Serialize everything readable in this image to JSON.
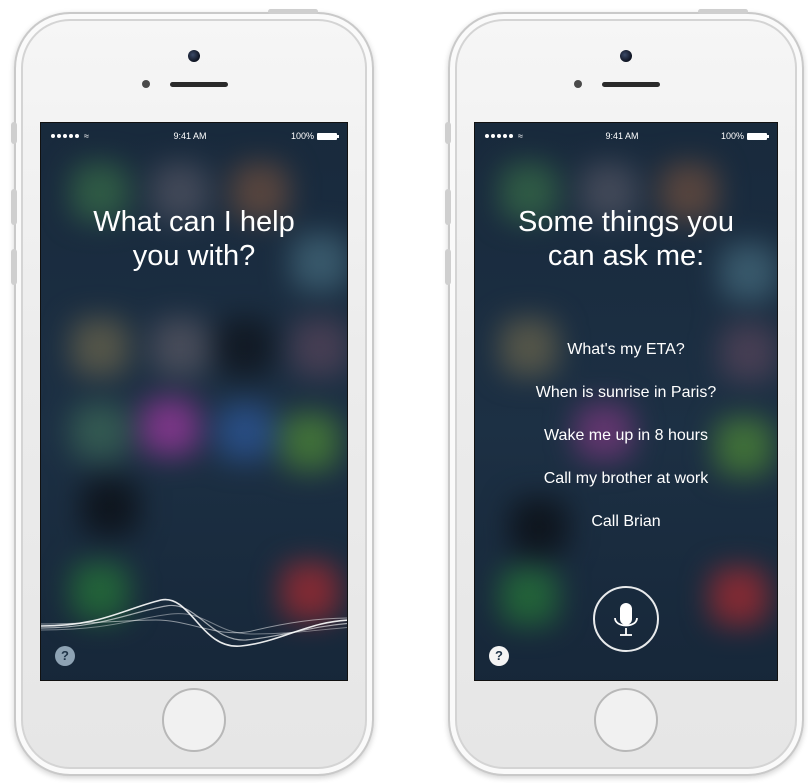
{
  "left_phone": {
    "status": {
      "time": "9:41 AM",
      "battery": "100%",
      "signal_dots": 5,
      "wifi_icon": "wifi-icon"
    },
    "prompt_lines": [
      "What can I help",
      "you with?"
    ],
    "help_label": "?",
    "indicator": "siri-waveform"
  },
  "right_phone": {
    "status": {
      "time": "9:41 AM",
      "battery": "100%",
      "signal_dots": 5,
      "wifi_icon": "wifi-icon"
    },
    "prompt_lines": [
      "Some things you",
      "can ask me:"
    ],
    "suggestions": [
      "What's my ETA?",
      "When is sunrise in Paris?",
      "Wake me up in 8 hours",
      "Call my brother at work",
      "Call Brian"
    ],
    "help_label": "?",
    "indicator": "microphone-button"
  },
  "colors": {
    "screen_bg": "#1f3448",
    "text": "#ffffff",
    "device_body": "#ececec"
  }
}
